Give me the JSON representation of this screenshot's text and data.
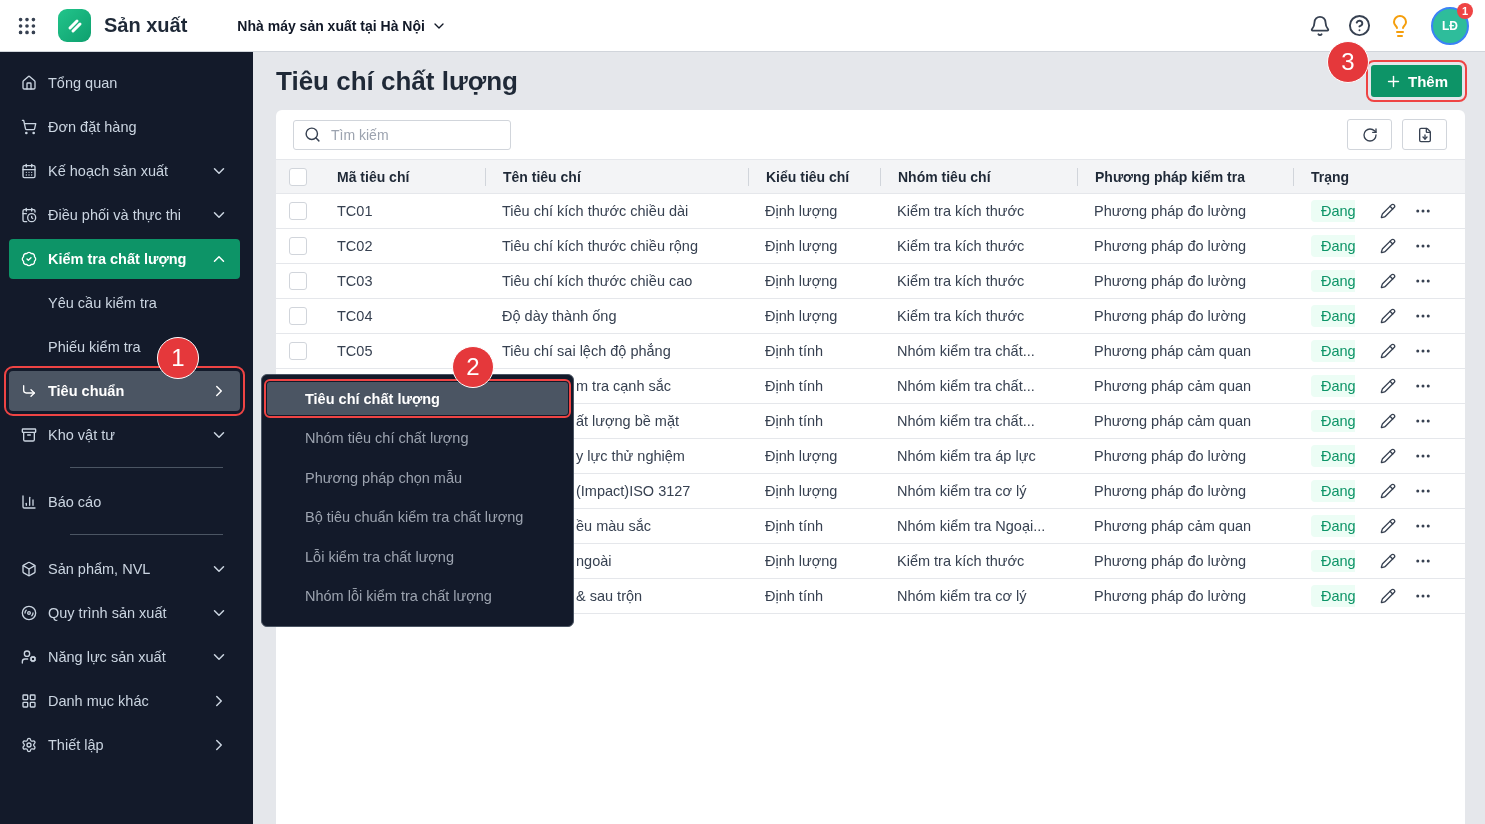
{
  "topbar": {
    "app_name": "Sản xuất",
    "factory": "Nhà máy sản xuất tại Hà Nội",
    "avatar": {
      "initials": "LĐ",
      "badge": "1"
    }
  },
  "sidebar": {
    "items": [
      {
        "kind": "link",
        "label": "Tổng quan",
        "selected": false
      },
      {
        "kind": "link",
        "label": "Đơn đặt hàng",
        "selected": false
      },
      {
        "kind": "group",
        "label": "Kế hoạch sản xuất",
        "selected": false,
        "expanded": false
      },
      {
        "kind": "group",
        "label": "Điều phối và thực thi",
        "selected": false,
        "expanded": false
      },
      {
        "kind": "group",
        "label": "Kiểm tra chất lượng",
        "selected": true,
        "expanded": true,
        "children": [
          {
            "kind": "link",
            "label": "Yêu cầu kiểm tra",
            "selected": false
          },
          {
            "kind": "link",
            "label": "Phiếu kiểm tra",
            "selected": false
          },
          {
            "kind": "flyout",
            "label": "Tiêu chuẩn",
            "selected": true,
            "callout": "1"
          }
        ]
      },
      {
        "kind": "group",
        "label": "Kho vật tư",
        "selected": false,
        "expanded": false
      },
      {
        "kind": "divider"
      },
      {
        "kind": "link",
        "label": "Báo cáo",
        "selected": false
      },
      {
        "kind": "divider"
      },
      {
        "kind": "group",
        "label": "Sản phẩm, NVL",
        "selected": false,
        "expanded": false
      },
      {
        "kind": "group",
        "label": "Quy trình sản xuất",
        "selected": false,
        "expanded": false
      },
      {
        "kind": "group",
        "label": "Năng lực sản xuất",
        "selected": false,
        "expanded": false
      },
      {
        "kind": "flyout",
        "label": "Danh mục khác",
        "selected": false
      },
      {
        "kind": "flyout",
        "label": "Thiết lập",
        "selected": false
      }
    ]
  },
  "flyout_menu": {
    "items": [
      {
        "label": "Tiêu chí chất lượng",
        "selected": true,
        "callout": "2"
      },
      {
        "label": "Nhóm tiêu chí chất lượng",
        "selected": false
      },
      {
        "label": "Phương pháp chọn mẫu",
        "selected": false
      },
      {
        "label": "Bộ tiêu chuẩn kiểm tra chất lượng",
        "selected": false
      },
      {
        "label": "Lỗi kiểm tra chất lượng",
        "selected": false
      },
      {
        "label": "Nhóm lỗi kiểm tra chất lượng",
        "selected": false
      }
    ]
  },
  "page": {
    "title": "Tiêu chí chất lượng",
    "add_button": {
      "label": "Thêm",
      "callout": "3"
    }
  },
  "search": {
    "placeholder": "Tìm kiếm"
  },
  "table": {
    "header_checked": false,
    "columns": [
      "Mã tiêu chí",
      "Tên tiêu chí",
      "Kiểu tiêu chí",
      "Nhóm tiêu chí",
      "Phương pháp kiểm tra",
      "Trạng"
    ],
    "rows": [
      {
        "checked": false,
        "covered": false,
        "code": "TC01",
        "name": "Tiêu chí kích thước chiều dài",
        "type": "Định lượng",
        "group": "Kiểm tra kích thước",
        "method": "Phương pháp đo lường",
        "status": "Đang"
      },
      {
        "checked": false,
        "covered": false,
        "code": "TC02",
        "name": "Tiêu chí kích thước chiều rộng",
        "type": "Định lượng",
        "group": "Kiểm tra kích thước",
        "method": "Phương pháp đo lường",
        "status": "Đang"
      },
      {
        "checked": false,
        "covered": false,
        "code": "TC03",
        "name": "Tiêu chí kích thước chiều cao",
        "type": "Định lượng",
        "group": "Kiểm tra kích thước",
        "method": "Phương pháp đo lường",
        "status": "Đang"
      },
      {
        "checked": false,
        "covered": false,
        "code": "TC04",
        "name": "Độ dày thành ống",
        "type": "Định lượng",
        "group": "Kiểm tra kích thước",
        "method": "Phương pháp đo lường",
        "status": "Đang"
      },
      {
        "checked": false,
        "covered": false,
        "code": "TC05",
        "name": "Tiêu chí sai lệch độ phẳng",
        "type": "Định tính",
        "group": "Nhóm kiểm tra chất...",
        "method": "Phương pháp cảm quan",
        "status": "Đang"
      },
      {
        "covered": true,
        "name": "m tra cạnh sắc",
        "type": "Định tính",
        "group": "Nhóm kiểm tra chất...",
        "method": "Phương pháp cảm quan",
        "status": "Đang"
      },
      {
        "covered": true,
        "name": "ất lượng bề mặt",
        "type": "Định tính",
        "group": "Nhóm kiểm tra chất...",
        "method": "Phương pháp cảm quan",
        "status": "Đang"
      },
      {
        "covered": true,
        "name": "y lực thử nghiệm",
        "type": "Định lượng",
        "group": "Nhóm kiểm tra áp lực",
        "method": "Phương pháp đo lường",
        "status": "Đang"
      },
      {
        "covered": true,
        "name": "(Impact)ISO 3127",
        "type": "Định lượng",
        "group": "Nhóm kiểm tra cơ lý",
        "method": "Phương pháp đo lường",
        "status": "Đang"
      },
      {
        "covered": true,
        "name": "ều màu sắc",
        "type": "Định tính",
        "group": "Nhóm kiểm tra Ngoại...",
        "method": "Phương pháp cảm quan",
        "status": "Đang"
      },
      {
        "covered": true,
        "name": "ngoài",
        "type": "Định lượng",
        "group": "Kiểm tra kích thước",
        "method": "Phương pháp đo lường",
        "status": "Đang"
      },
      {
        "covered": true,
        "name": "& sau trộn",
        "type": "Định tính",
        "group": "Nhóm kiểm tra cơ lý",
        "method": "Phương pháp đo lường",
        "status": "Đang"
      }
    ]
  }
}
